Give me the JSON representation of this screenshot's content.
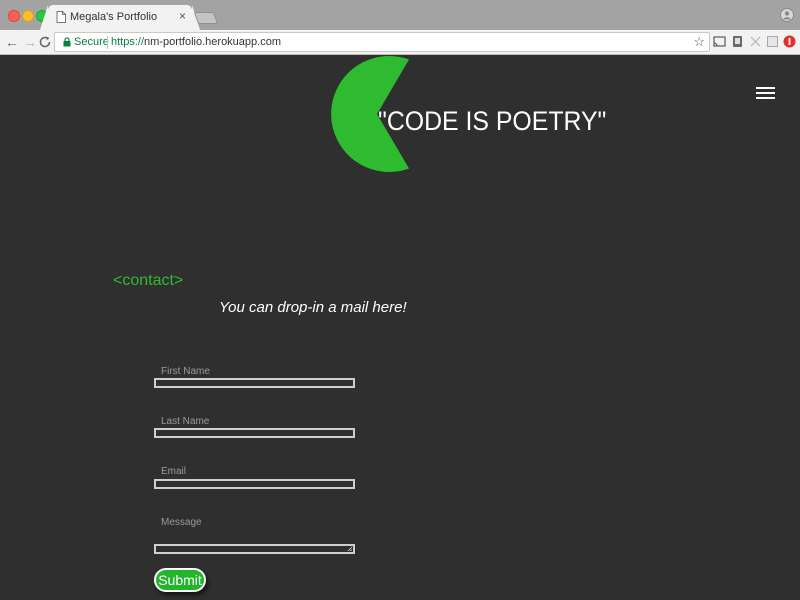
{
  "browser": {
    "tab_title": "Megala's Portfolio",
    "tab_close": "×",
    "secure_label": "Secure",
    "url_scheme": "https://",
    "url_host": "nm-portfolio.herokuapp.com",
    "nav_back": "←",
    "nav_forward": "→",
    "nav_reload": "C",
    "star": "☆"
  },
  "hero": {
    "quote": "\"CODE IS POETRY\"",
    "logo_icon": "pacman-icon",
    "accent_color": "#2fbb2f"
  },
  "contact": {
    "section_title": "<contact>",
    "subtitle": "You can drop-in a mail here!",
    "fields": {
      "first_name": "First Name",
      "last_name": "Last Name",
      "email": "Email",
      "message": "Message"
    },
    "submit_label": "Submit"
  },
  "colors": {
    "background": "#2f2f2f",
    "accent": "#2fbb2f",
    "button": "#21b52b"
  }
}
